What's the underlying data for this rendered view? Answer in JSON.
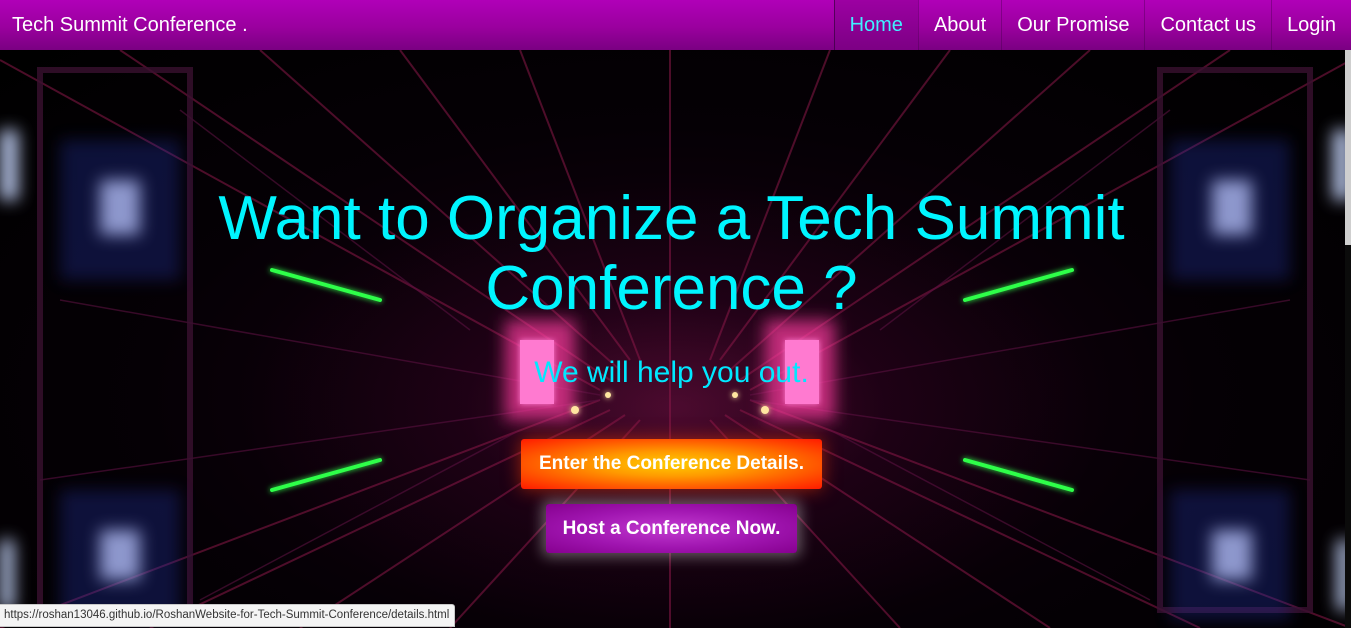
{
  "navbar": {
    "brand": "Tech Summit Conference .",
    "items": [
      {
        "label": "Home",
        "active": true
      },
      {
        "label": "About",
        "active": false
      },
      {
        "label": "Our Promise",
        "active": false
      },
      {
        "label": "Contact us",
        "active": false
      },
      {
        "label": "Login",
        "active": false
      }
    ]
  },
  "hero": {
    "headline_line1": "Want to Organize a Tech Summit",
    "headline_line2": "Conference ?",
    "subline": "We will help you out.",
    "primary_button": "Enter the Conference Details.",
    "secondary_button": "Host a Conference Now."
  },
  "status_bar": {
    "url": "https://roshan13046.github.io/RoshanWebsite-for-Tech-Summit-Conference/details.html"
  },
  "colors": {
    "navbar": "#9a009e",
    "active_nav_text": "#3ff0ff",
    "headline": "#00f5ff",
    "primary_button": "#ff4a00",
    "secondary_button": "#a015b0"
  },
  "icons": []
}
